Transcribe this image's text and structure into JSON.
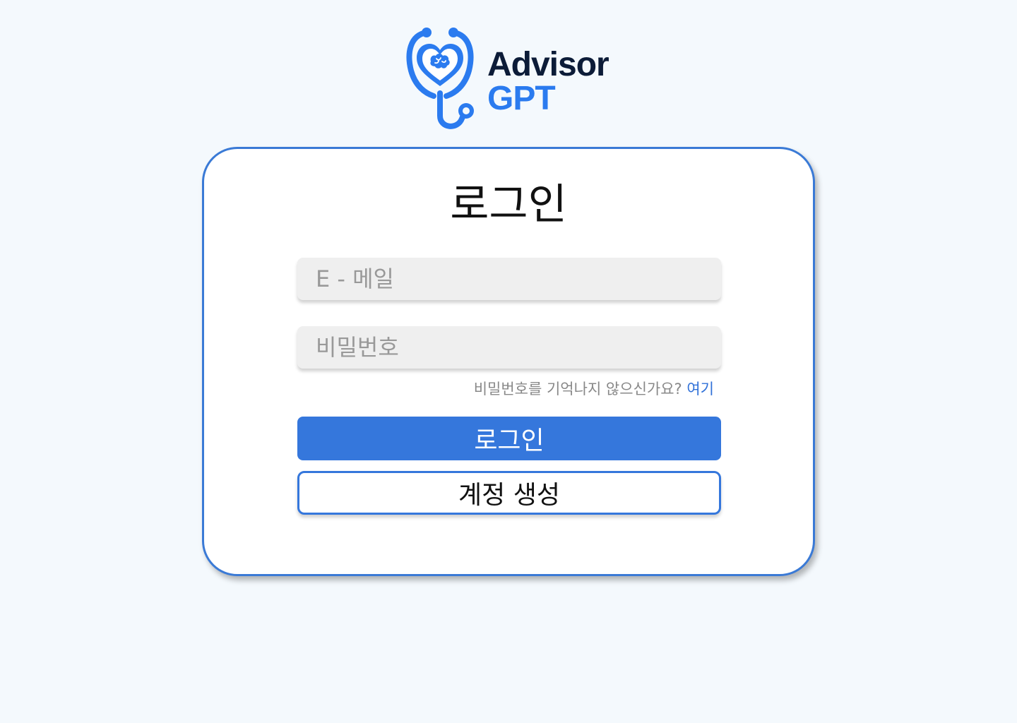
{
  "brand": {
    "name_line1": "Advisor",
    "name_line2": "GPT",
    "logo_icon": "stethoscope-heart-brain-icon",
    "colors": {
      "primary": "#2b7bef",
      "dark": "#0c1c38"
    }
  },
  "login_card": {
    "title": "로그인",
    "email_placeholder": "E - 메일",
    "password_placeholder": "비밀번호",
    "forgot_text": "비밀번호를 기억나지 않으신가요? ",
    "forgot_link": "여기",
    "login_button": "로그인",
    "signup_button": "계정 생성"
  },
  "colors": {
    "background": "#f4f9fd",
    "accent": "#3577dc",
    "card_border": "#3a7ad6"
  }
}
